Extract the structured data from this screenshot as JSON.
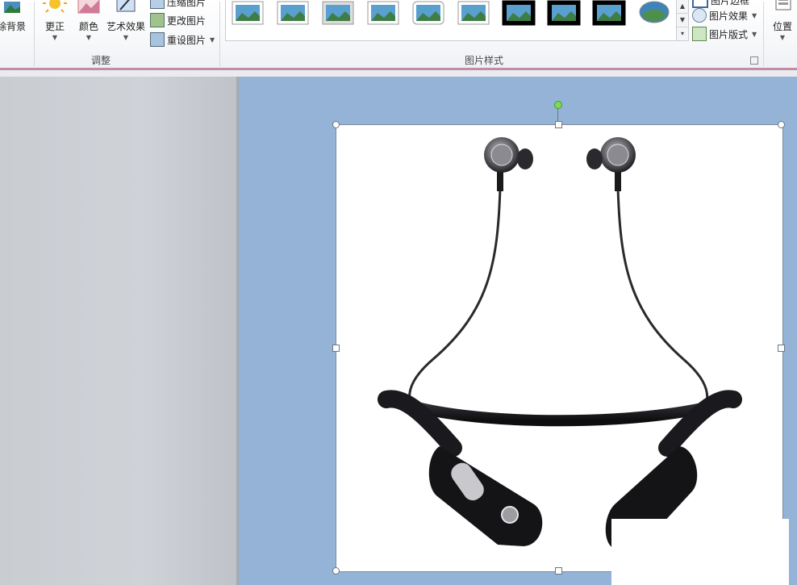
{
  "ribbon": {
    "adjust": {
      "remove_bg_label": "除背景",
      "corrections_label": "更正",
      "color_label": "颜色",
      "artistic_label": "艺术效果",
      "compress_label": "压缩图片",
      "change_label": "更改图片",
      "reset_label": "重设图片",
      "group_label": "调整"
    },
    "styles": {
      "group_label": "图片样式",
      "border_label": "图片边框",
      "effects_label": "图片效果",
      "layout_label": "图片版式",
      "thumbnails": [
        "simple-frame-white",
        "soft-edge",
        "beveled-frame",
        "drop-shadow",
        "reflected-rounded",
        "soft-edge-oval",
        "double-frame-black",
        "thick-matte-black",
        "simple-frame-black",
        "oval"
      ]
    },
    "arrange": {
      "position_label": "位置"
    }
  },
  "colors": {
    "slide_bg": "#95b3d7",
    "ribbon_accent": "#c58aa6",
    "left_panel": "#cdd1d6"
  },
  "picture": {
    "subject": "neckband-bluetooth-earphones"
  }
}
